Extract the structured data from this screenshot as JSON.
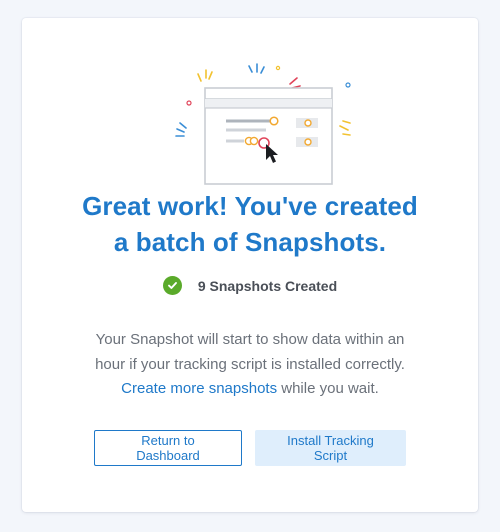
{
  "headline": {
    "line1": "Great work! You've created",
    "line2": "a batch of Snapshots."
  },
  "status": {
    "icon": "check-circle-icon",
    "text": "9 Snapshots Created"
  },
  "description": {
    "line1": "Your Snapshot will start to show data within an",
    "line2": "hour if your tracking script is installed correctly.",
    "link_text": "Create more snapshots",
    "line3_suffix": " while you wait."
  },
  "buttons": {
    "dashboard": "Return to Dashboard",
    "install": "Install Tracking Script"
  },
  "colors": {
    "accent": "#1f79c9",
    "success": "#5aaa2a",
    "button_fill": "#dfeefc",
    "page_background": "#f3f6fb"
  }
}
